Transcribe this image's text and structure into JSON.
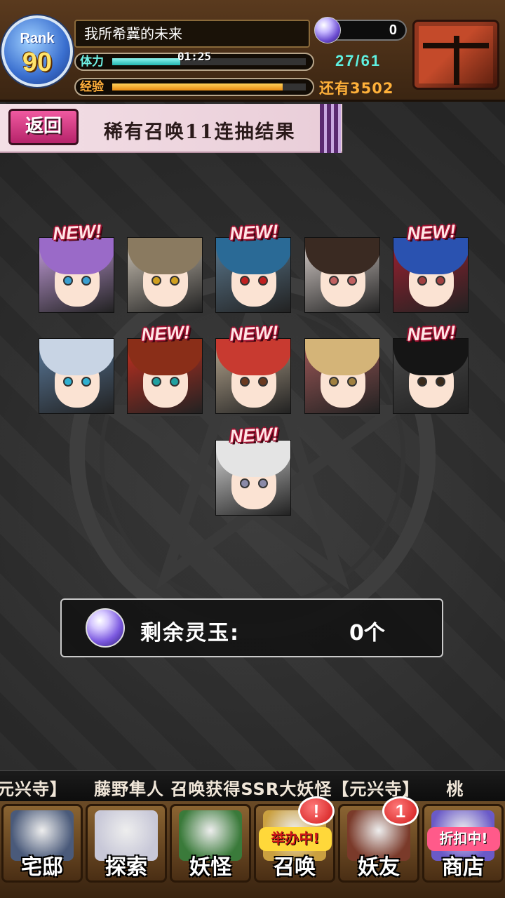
{
  "header": {
    "rank_label": "Rank",
    "rank_value": "90",
    "player_name": "我所希冀的未来",
    "stamina_label": "体力",
    "stamina_timer": "01:25",
    "stamina_fill": 0.35,
    "exp_label": "经验",
    "exp_fill": 0.88,
    "orb_count": "0",
    "stamina_count": "27/61",
    "exp_remaining": "还有3502"
  },
  "banner": {
    "back_label": "返回",
    "title": "稀有召唤11连抽结果"
  },
  "results": {
    "new_label": "NEW!",
    "cards": [
      {
        "is_new": true,
        "hair": "#9a6ac8",
        "bg": "#c8a0e0",
        "eye": "#3a9fd0"
      },
      {
        "is_new": false,
        "hair": "#8a7a60",
        "bg": "#cfc6b8",
        "eye": "#d0a020"
      },
      {
        "is_new": true,
        "hair": "#2a6a96",
        "bg": "#5c7a90",
        "eye": "#c02020"
      },
      {
        "is_new": false,
        "hair": "#3a2a22",
        "bg": "#d9d0cc",
        "eye": "#c06060"
      },
      {
        "is_new": true,
        "hair": "#2a52b0",
        "bg": "#a02030",
        "eye": "#a04040"
      },
      {
        "is_new": false,
        "hair": "#c8d4e4",
        "bg": "#5a7a9c",
        "eye": "#30b0d0"
      },
      {
        "is_new": true,
        "hair": "#8a2e18",
        "bg": "#c83020",
        "eye": "#20a0a0"
      },
      {
        "is_new": true,
        "hair": "#c83a30",
        "bg": "#b8a890",
        "eye": "#6a3a20"
      },
      {
        "is_new": false,
        "hair": "#d4b478",
        "bg": "#a05858",
        "eye": "#a08040"
      },
      {
        "is_new": true,
        "hair": "#151515",
        "bg": "#4a4a4a",
        "eye": "#3a2a1a"
      },
      {
        "is_new": true,
        "hair": "#e4e4e4",
        "bg": "#d8d8d8",
        "eye": "#8a8aa8"
      }
    ]
  },
  "orb_panel": {
    "label": "剩余灵玉:",
    "value": "0个"
  },
  "ticker": {
    "text": "元兴寺】　　藤野隼人 召唤获得SSR大妖怪【元兴寺】　　桃"
  },
  "nav": {
    "items": [
      {
        "label": "宅邸",
        "art": "#4a5a7a",
        "event": "",
        "alert": ""
      },
      {
        "label": "探索",
        "art": "#c8c8d8",
        "event": "",
        "alert": ""
      },
      {
        "label": "妖怪",
        "art": "#3a7a3a",
        "event": "",
        "alert": ""
      },
      {
        "label": "召唤",
        "art": "#caa040",
        "event": "举办中!",
        "alert": "!"
      },
      {
        "label": "妖友",
        "art": "#7a3a2a",
        "event": "",
        "alert": "1"
      },
      {
        "label": "商店",
        "art": "#6a5ac8",
        "event": "折扣中!",
        "alert": ""
      }
    ]
  },
  "colors": {
    "accent_pink": "#d8367e",
    "stamina": "#22b5b0",
    "exp": "#e88b12"
  }
}
